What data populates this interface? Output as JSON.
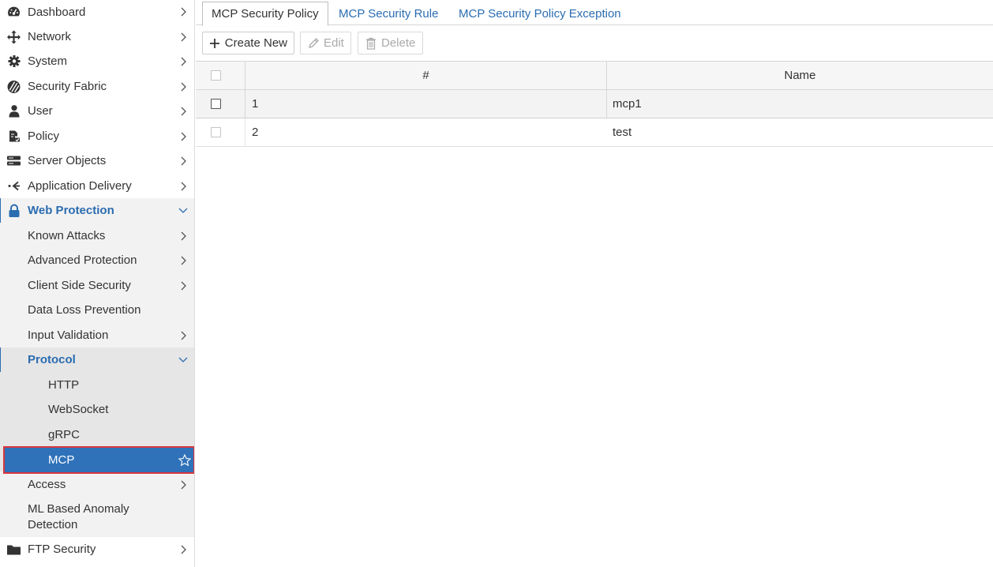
{
  "sidebar": {
    "items": [
      {
        "label": "Dashboard",
        "icon": "dashboard-icon"
      },
      {
        "label": "Network",
        "icon": "network-icon"
      },
      {
        "label": "System",
        "icon": "gear-icon"
      },
      {
        "label": "Security Fabric",
        "icon": "security-fabric-icon"
      },
      {
        "label": "User",
        "icon": "user-icon"
      },
      {
        "label": "Policy",
        "icon": "policy-icon"
      },
      {
        "label": "Server Objects",
        "icon": "server-icon"
      },
      {
        "label": "Application Delivery",
        "icon": "application-delivery-icon"
      },
      {
        "label": "Web Protection",
        "icon": "lock-icon"
      },
      {
        "label": "FTP Security",
        "icon": "folder-icon"
      }
    ],
    "web_protection_children": [
      {
        "label": "Known Attacks"
      },
      {
        "label": "Advanced Protection"
      },
      {
        "label": "Client Side Security"
      },
      {
        "label": "Data Loss Prevention"
      },
      {
        "label": "Input Validation"
      },
      {
        "label": "Protocol"
      },
      {
        "label": "Access"
      },
      {
        "label": "ML Based Anomaly Detection"
      }
    ],
    "protocol_children": [
      {
        "label": "HTTP"
      },
      {
        "label": "WebSocket"
      },
      {
        "label": "gRPC"
      },
      {
        "label": "MCP"
      }
    ],
    "colors": {
      "accent": "#2b6cb0",
      "selected_bg": "#2f72b9",
      "highlight_border": "#d9363e"
    }
  },
  "tabs": [
    {
      "label": "MCP Security Policy",
      "active": true
    },
    {
      "label": "MCP Security Rule",
      "active": false
    },
    {
      "label": "MCP Security Policy Exception",
      "active": false
    }
  ],
  "toolbar": {
    "create_label": "Create New",
    "edit_label": "Edit",
    "delete_label": "Delete"
  },
  "table": {
    "columns": [
      "#",
      "Name"
    ],
    "rows": [
      {
        "num": "1",
        "name": "mcp1"
      },
      {
        "num": "2",
        "name": "test"
      }
    ]
  }
}
